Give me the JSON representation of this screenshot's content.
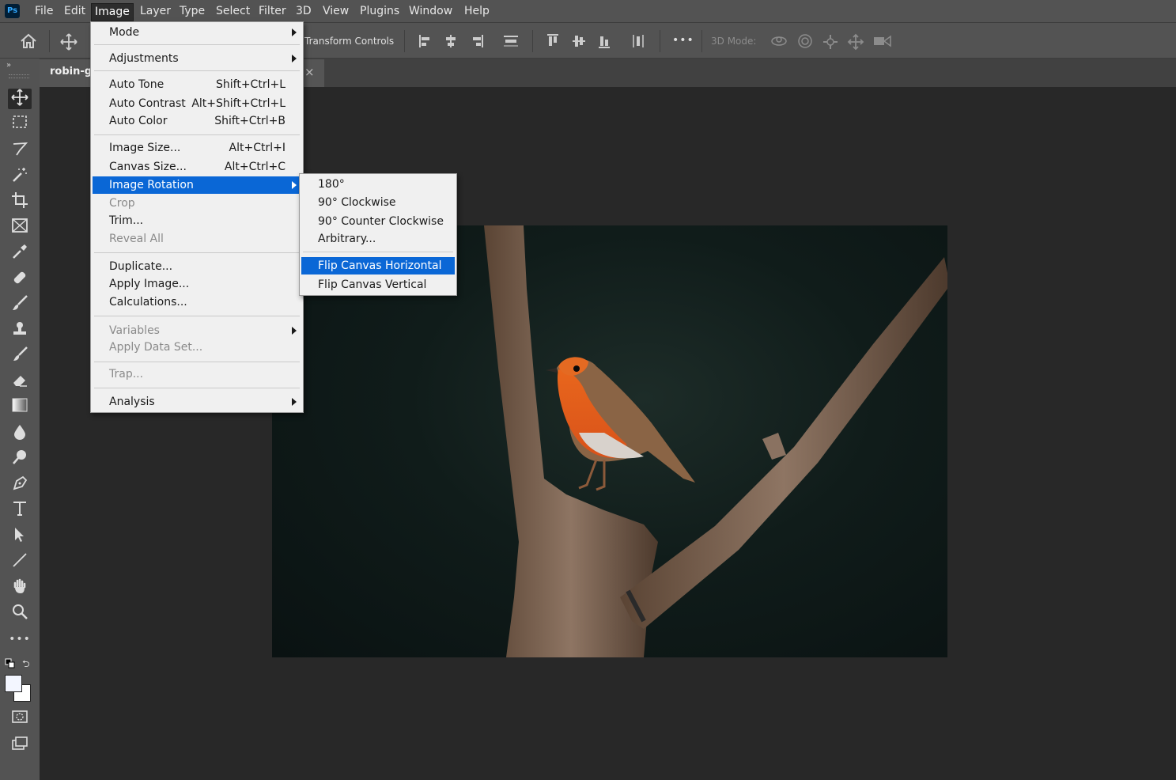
{
  "app": {
    "logo": "Ps"
  },
  "menubar": {
    "items": [
      "File",
      "Edit",
      "Image",
      "Layer",
      "Type",
      "Select",
      "Filter",
      "3D",
      "View",
      "Plugins",
      "Window",
      "Help"
    ],
    "active": "Image"
  },
  "options_bar": {
    "transform_controls_label": "Transform Controls",
    "three_d_mode_label": "3D Mode:",
    "more_label": "•••"
  },
  "document": {
    "tab_title": "robin-g",
    "close_glyph": "×"
  },
  "image_menu": {
    "items": [
      {
        "label": "Mode",
        "shortcut": "",
        "submenu": true,
        "disabled": false
      },
      {
        "label": "Adjustments",
        "shortcut": "",
        "submenu": true,
        "disabled": false
      },
      {
        "label": "Auto Tone",
        "shortcut": "Shift+Ctrl+L",
        "submenu": false,
        "disabled": false
      },
      {
        "label": "Auto Contrast",
        "shortcut": "Alt+Shift+Ctrl+L",
        "submenu": false,
        "disabled": false
      },
      {
        "label": "Auto Color",
        "shortcut": "Shift+Ctrl+B",
        "submenu": false,
        "disabled": false
      },
      {
        "label": "Image Size...",
        "shortcut": "Alt+Ctrl+I",
        "submenu": false,
        "disabled": false
      },
      {
        "label": "Canvas Size...",
        "shortcut": "Alt+Ctrl+C",
        "submenu": false,
        "disabled": false
      },
      {
        "label": "Image Rotation",
        "shortcut": "",
        "submenu": true,
        "disabled": false,
        "highlighted": true
      },
      {
        "label": "Crop",
        "shortcut": "",
        "submenu": false,
        "disabled": true
      },
      {
        "label": "Trim...",
        "shortcut": "",
        "submenu": false,
        "disabled": false
      },
      {
        "label": "Reveal All",
        "shortcut": "",
        "submenu": false,
        "disabled": true
      },
      {
        "label": "Duplicate...",
        "shortcut": "",
        "submenu": false,
        "disabled": false
      },
      {
        "label": "Apply Image...",
        "shortcut": "",
        "submenu": false,
        "disabled": false
      },
      {
        "label": "Calculations...",
        "shortcut": "",
        "submenu": false,
        "disabled": false
      },
      {
        "label": "Variables",
        "shortcut": "",
        "submenu": true,
        "disabled": true
      },
      {
        "label": "Apply Data Set...",
        "shortcut": "",
        "submenu": false,
        "disabled": true
      },
      {
        "label": "Trap...",
        "shortcut": "",
        "submenu": false,
        "disabled": true
      },
      {
        "label": "Analysis",
        "shortcut": "",
        "submenu": true,
        "disabled": false
      }
    ]
  },
  "rotation_submenu": {
    "items": [
      {
        "label": "180°"
      },
      {
        "label": "90° Clockwise"
      },
      {
        "label": "90° Counter Clockwise"
      },
      {
        "label": "Arbitrary..."
      },
      {
        "label": "Flip Canvas Horizontal",
        "highlighted": true
      },
      {
        "label": "Flip Canvas Vertical"
      }
    ]
  },
  "colors": {
    "accent": "#0a67d6",
    "menubar": "#535353",
    "workspace": "#282828",
    "logo_bg": "#001e36",
    "logo_fg": "#31a8ff"
  },
  "tools": [
    "move-tool-icon",
    "marquee-tool-icon",
    "lasso-tool-icon",
    "magic-wand-icon",
    "crop-tool-icon",
    "frame-tool-icon",
    "eyedropper-icon",
    "healing-brush-icon",
    "brush-icon",
    "clone-stamp-icon",
    "history-brush-icon",
    "eraser-icon",
    "gradient-icon",
    "blur-icon",
    "dodge-icon",
    "pen-icon",
    "type-icon",
    "path-selection-icon",
    "line-icon",
    "hand-icon",
    "zoom-icon",
    "more-tools-icon"
  ]
}
